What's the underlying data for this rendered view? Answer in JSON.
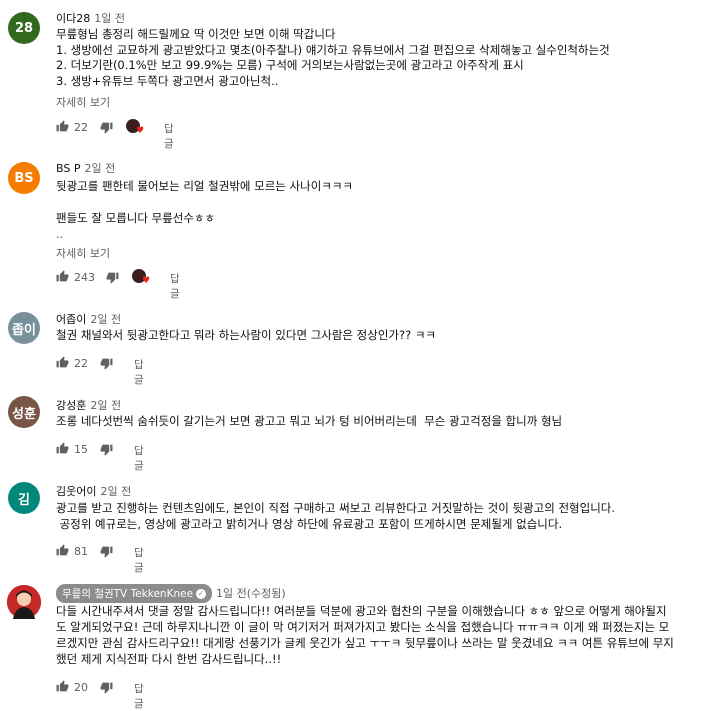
{
  "reply_label": "답글",
  "show_more_label": "자세히 보기",
  "comments": [
    {
      "avatar_text": "28",
      "avatar_color": "#33691e",
      "author": "이다28",
      "time": "1일 전",
      "lines": [
        "무릎형님 총정리 해드릴께요 딱 이것만 보면 이해 딱갑니다",
        "1. 생방에선 교묘하게 광고받았다고 몇초(아주찰나) 얘기하고 유튜브에서 그걸 편집으로 삭제해놓고 실수인척하는것",
        "2. 더보기란(0.1%만 보고 99.9%는 모름) 구석에 거의보는사람없는곳에 광고라고 아주작게 표시",
        "3. 생방+유튜브 두쪽다 광고면서 광고아닌척.."
      ],
      "likes": "22"
    },
    {
      "avatar_text": "BS",
      "avatar_color": "#f57c00",
      "author": "BS P",
      "time": "2일 전",
      "lines": [
        "뒷광고를 팬한테 물어보는 리얼 철권밖에 모르는 사나이ㅋㅋㅋ",
        "",
        "팬들도 잘 모릅니다 무릎선수ㅎㅎ",
        ".."
      ],
      "likes": "243"
    },
    {
      "avatar_text": "좁이",
      "avatar_color": "#78909c",
      "author": "어좁이",
      "time": "2일 전",
      "lines": [
        "철권 채널와서 뒷광고한다고 뭐라 하는사람이 있다면 그사람은 정상인가?? ㅋㅋ"
      ],
      "likes": "22"
    },
    {
      "avatar_text": "성훈",
      "avatar_color": "#795548",
      "author": "강성훈",
      "time": "2일 전",
      "lines": [
        "조롱 네다섯번씩 숨쉬듯이 갈기는거 보면 광고고 뭐고 뇌가 텅 비어버리는데  무슨 광고걱정을 합니까 형님"
      ],
      "likes": "15"
    },
    {
      "avatar_text": "김",
      "avatar_color": "#00897b",
      "author": "김웃어이",
      "time": "2일 전",
      "lines": [
        "광고를 받고 진행하는 컨텐츠임에도, 본인이 직접 구매하고 써보고 리뷰한다고 거짓말하는 것이 뒷광고의 전형입니다.",
        " 공정위 예규로는, 영상에 광고라고 밝히거나 영상 하단에 유료광고 포함이 뜨게하시면 문제될게 없습니다."
      ],
      "likes": "81"
    },
    {
      "avatar_text": "",
      "avatar_color": "#b71c1c",
      "author": "무릎의 철권TV TekkenKnee",
      "time": "1일 전(수정됨)",
      "lines": [
        "다들 시간내주셔서 댓글 정말 감사드립니다!! 여러분들 덕분에 광고와 협찬의 구분을 이해했습니다 ㅎㅎ 앞으로 어떻게 해야될지",
        "도 알게되었구요! 근데 하루지나니깐 이 글이 막 여기저거 퍼져가지고 봤다는 소식을 접했습니다 ㅠㅠㅋㅋ 이게 왜 퍼졌는지는 모",
        "르겠지만 관심 감사드리구요!! 대게랑 선풍기가 글케 웃긴가 싶고 ㅜㅜㅋ 뒷무릎이나 쓰라는 말 웃겼네요 ㅋㅋ 여튼 유튜브에 무지",
        "했던 제게 지식전파 다시 한번 감사드립니다..!!"
      ],
      "likes": "20"
    }
  ]
}
